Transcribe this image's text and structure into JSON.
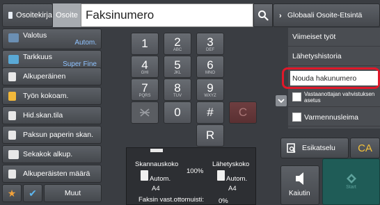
{
  "header": {
    "address_book": "Osoitekirja",
    "address_tab": "Osoite",
    "fax_number_field": "Faksinumero"
  },
  "left_panel": {
    "valotus": {
      "label": "Valotus",
      "value": "Autom."
    },
    "tarkkuus": {
      "label": "Tarkkuus",
      "value": "Super Fine"
    },
    "alkuperainen": "Alkuperäinen",
    "tyon_kokoam": "Työn kokoam.",
    "hid_skan_tila": "Hid.skan.tila",
    "paksun_paperin": "Paksun paperin skan.",
    "sekakok": "Sekakok alkup.",
    "alkuperaisten_maara": "Alkuperäisten määrä",
    "muut": "Muut"
  },
  "keypad": {
    "k1": "1",
    "k2": "2",
    "k2s": "ABC",
    "k3": "3",
    "k3s": "DEF",
    "k4": "4",
    "k4s": "GHI",
    "k5": "5",
    "k5s": "JKL",
    "k6": "6",
    "k6s": "MNO",
    "k7": "7",
    "k7s": "PQRS",
    "k8": "8",
    "k8s": "TUV",
    "k9": "9",
    "k9s": "WXYZ",
    "k0": "0",
    "khash": "#",
    "kc": "C",
    "kr": "R"
  },
  "scan_info": {
    "scan_size_label": "Skannauskoko",
    "scan_size_value": "Autom.",
    "scan_paper": "A4",
    "ratio": "100%",
    "send_size_label": "Lähetyskoko",
    "send_size_value": "Autom.",
    "send_paper": "A4",
    "memory_label": "Faksin vast.ottomuisti:",
    "memory_value": "0%"
  },
  "right_panel": {
    "globaali": "Globaali Osoite-Etsintä",
    "viimeiset": "Viimeiset työt",
    "lahetyshistoria": "Lähetyshistoria",
    "nouda": "Nouda hakunumero",
    "vastaanottajan": "Vastaanottajan vahvistuksen asetus",
    "varmennusleima": "Varmennusleima",
    "esikatselu": "Esikatselu",
    "ca": "CA",
    "kaiutin": "Kaiutin",
    "start": "Start"
  }
}
